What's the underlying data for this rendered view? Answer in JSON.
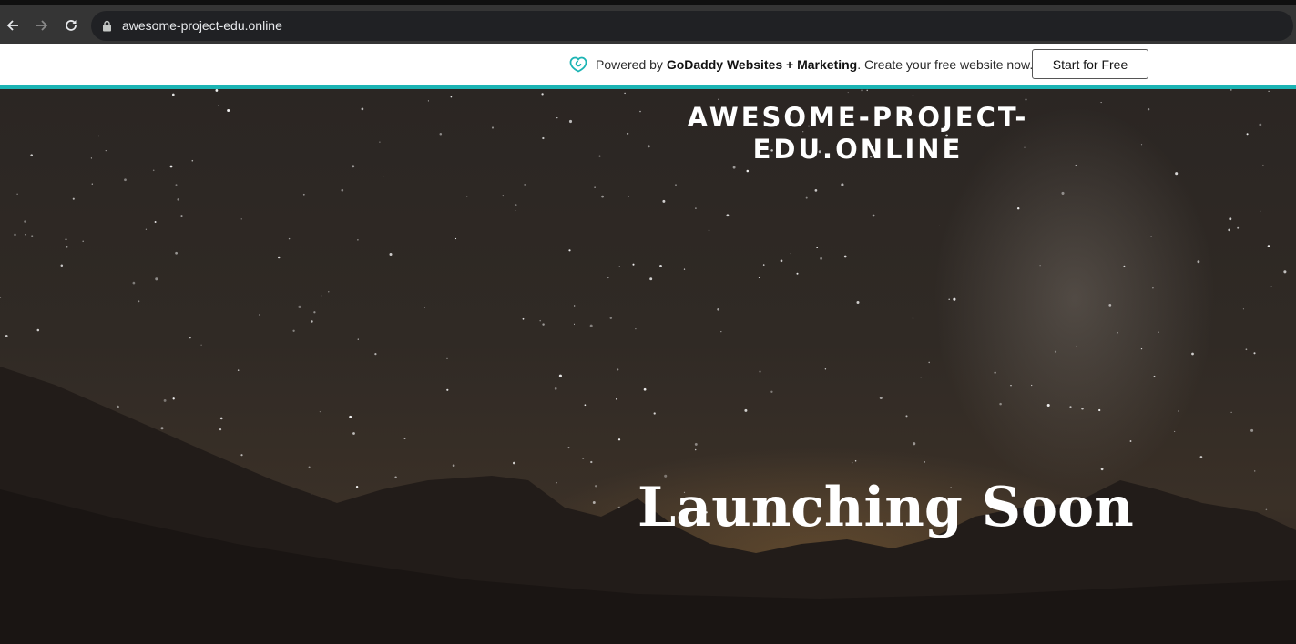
{
  "browser": {
    "url": "awesome-project-edu.online",
    "icons": [
      "back-arrow-icon",
      "forward-arrow-icon",
      "reload-icon",
      "lock-icon"
    ]
  },
  "promo": {
    "prefix": "Powered by ",
    "brand": "GoDaddy Websites + Marketing",
    "suffix": ". Create your free website now.",
    "cta_label": "Start for Free",
    "accent_color": "#1bb4b4"
  },
  "hero": {
    "site_title_line1": "AWESOME-PROJECT-",
    "site_title_line2": "EDU.ONLINE",
    "heading": "Launching Soon"
  }
}
